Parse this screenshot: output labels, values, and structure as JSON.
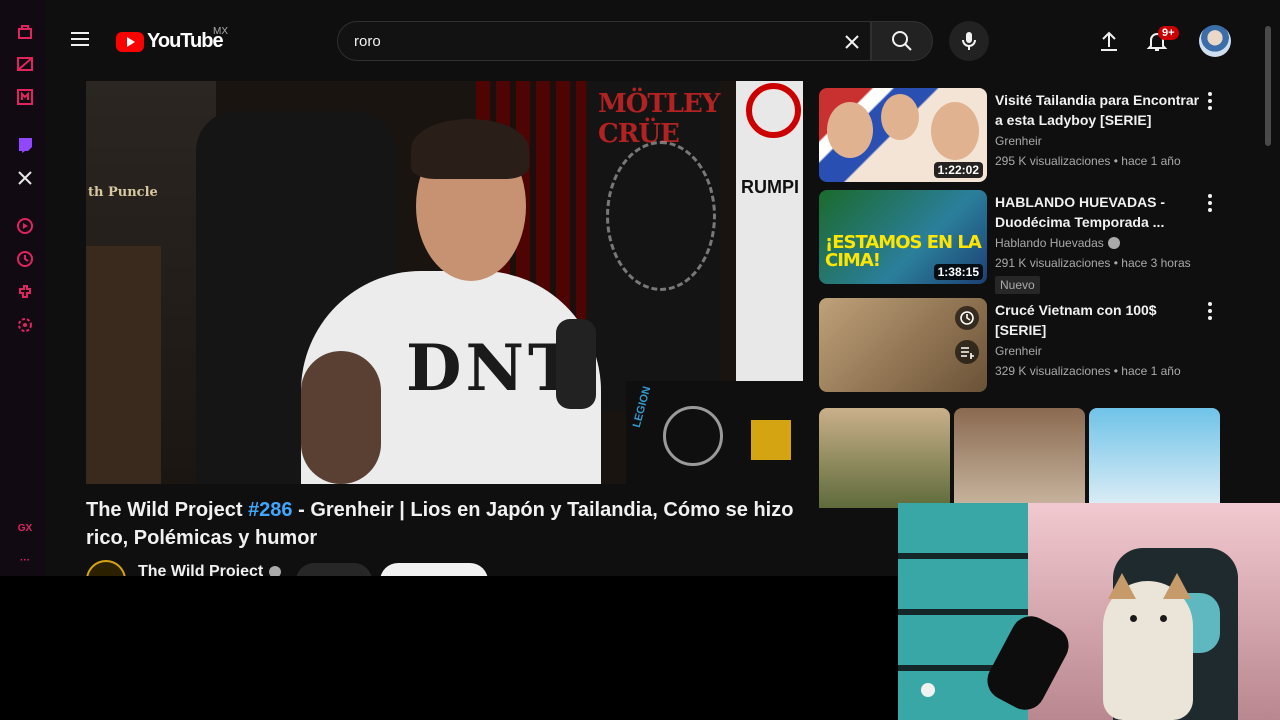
{
  "header": {
    "logo_text": "YouTube",
    "country": "MX",
    "search_value": "roro",
    "notifications_badge": "9+"
  },
  "sidebar": {
    "gx_label": "GX",
    "more_label": "···"
  },
  "player": {
    "poster_text": "th Puncle",
    "motley_text": "MÖTLEY CRÜE",
    "rump_text": "RUMPI",
    "shirt_text": "DNT",
    "legion_text": "LEGION"
  },
  "video": {
    "title_prefix": "The Wild Project ",
    "title_hashtag": "#286",
    "title_suffix": " - Grenheir | Lios en Japón y Tailandia, Cómo se hizo rico, Polémicas y humor",
    "channel_name": "The Wild Project"
  },
  "recommendations": [
    {
      "title": "Visité Tailandia para Encontrar a esta Ladyboy [SERIE]",
      "channel": "Grenheir",
      "meta": "295 K visualizaciones • hace 1 año",
      "duration": "1:22:02"
    },
    {
      "title": "HABLANDO HUEVADAS - Duodécima Temporada ...",
      "channel": "Hablando Huevadas",
      "meta": "291 K visualizaciones • hace 3 horas",
      "duration": "1:38:15",
      "badge": "Nuevo",
      "thumb_text": "¡ESTAMOS EN LA CIMA!"
    },
    {
      "title": "Crucé Vietnam con 100$ [SERIE]",
      "channel": "Grenheir",
      "meta": "329 K visualizaciones • hace 1 año"
    }
  ],
  "colors": {
    "accent": "#ff0000",
    "gx_accent": "#e0245e",
    "link_blue": "#3ea6ff"
  }
}
